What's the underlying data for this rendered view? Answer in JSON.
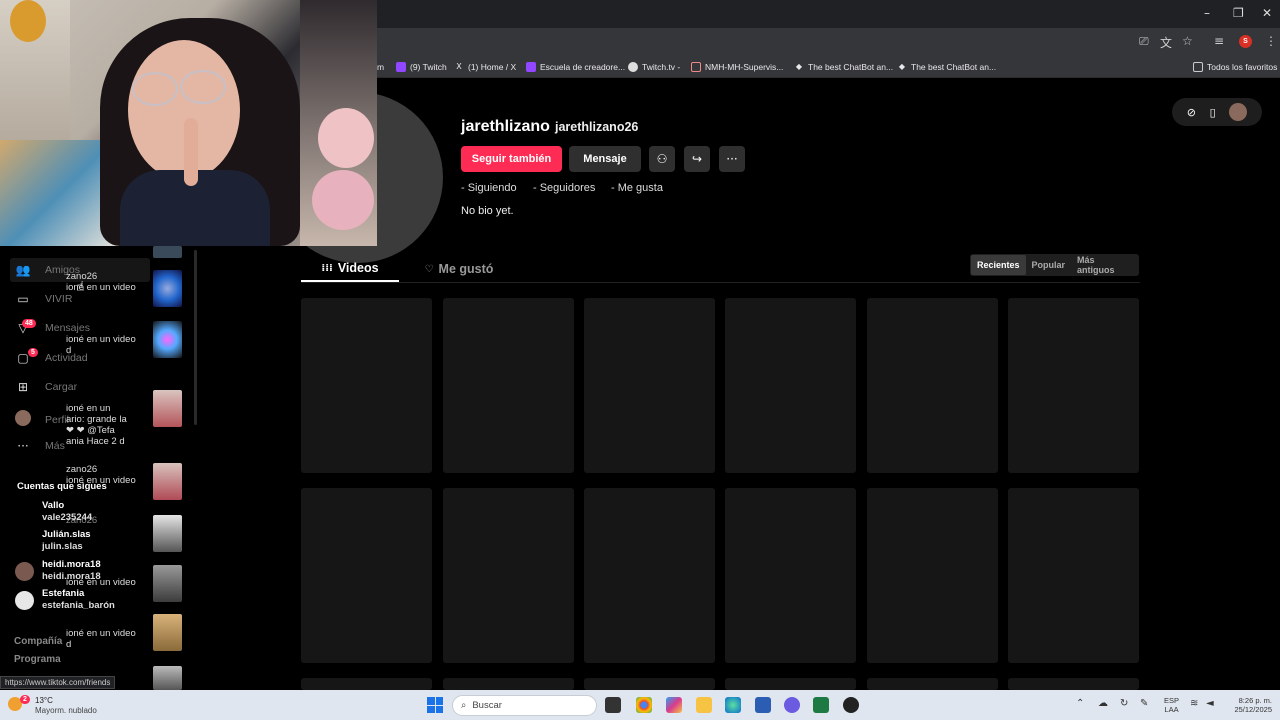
{
  "browser": {
    "window_controls": {
      "minimize": "–",
      "maximize": "❐",
      "close": "✕"
    },
    "bookmarks": [
      {
        "label": "m",
        "icon": ""
      },
      {
        "label": "(9) Twitch",
        "icon": "twitch-icon"
      },
      {
        "label": "(1) Home / X",
        "icon": "x-icon"
      },
      {
        "label": "Escuela de creadore...",
        "icon": "twitch-icon"
      },
      {
        "label": "Twitch.tv -",
        "icon": "globe-icon"
      },
      {
        "label": "NMH-MH-Supervis...",
        "icon": "doc-icon"
      },
      {
        "label": "The best ChatBot an...",
        "icon": "bot-icon"
      },
      {
        "label": "The best ChatBot an...",
        "icon": "bot-icon"
      }
    ],
    "all_bookmarks": "Todos los favoritos",
    "profile_initial": "S"
  },
  "profile": {
    "name": "jarethlizano",
    "handle": "jarethlizano26",
    "follow_label": "Seguir también",
    "message_label": "Mensaje",
    "stats": {
      "following": "- Siguiendo",
      "followers": "- Seguidores",
      "likes": "- Me gusta"
    },
    "bio": "No bio yet."
  },
  "tabs": {
    "videos": "Videos",
    "liked": "Me gustó"
  },
  "sort": [
    "Recientes",
    "Popular",
    "Más antiguos"
  ],
  "sidebar": {
    "nav": [
      {
        "label": "Amigos",
        "icon": "👥"
      },
      {
        "label": "VIVIR",
        "icon": "▭"
      },
      {
        "label": "Mensajes",
        "icon": "▽",
        "badge": "48"
      },
      {
        "label": "Actividad",
        "icon": "▢",
        "badge": "5"
      },
      {
        "label": "Cargar",
        "icon": "⊞"
      },
      {
        "label": "Perfil",
        "icon": ""
      },
      {
        "label": "Más",
        "icon": "···"
      }
    ],
    "notifications": [
      {
        "line1": "zano26",
        "line2": "ioné en un video"
      },
      {
        "line1": "ioné en un video",
        "line2": "d"
      },
      {
        "line1": "ioné en un",
        "line2": "ario: grande la"
      },
      {
        "line1": "❤ ❤ @Tefa",
        "line2": "ania  Hace 2 d"
      },
      {
        "line1": "zano26",
        "line2": "ioné en un video"
      },
      {
        "line1": "zano26",
        "line2": ""
      },
      {
        "line1": "ioné en un video",
        "line2": ""
      },
      {
        "line1": "ioné en un video",
        "line2": "d"
      }
    ],
    "following_header": "Cuentas que sigues",
    "following": [
      {
        "name": "Vallo",
        "handle": "vale235244"
      },
      {
        "name": "Julián.slas",
        "handle": "julin.slas"
      },
      {
        "name": "heidi.mora18",
        "handle": "heidi.mora18"
      },
      {
        "name": "Estefania",
        "handle": "estefania_barón"
      }
    ],
    "footer": [
      "Compañía",
      "Programa"
    ]
  },
  "status_url": "https://www.tiktok.com/friends",
  "taskbar": {
    "weather_temp": "13°C",
    "weather_desc": "Mayorm. nublado",
    "weather_badge": "2",
    "search_placeholder": "Buscar",
    "lang_1": "ESP",
    "lang_2": "LAA",
    "time": "8:26 p. m.",
    "date": "25/12/2025"
  },
  "colors": {
    "accent": "#fe2c55",
    "background": "#000000",
    "placeholder": "#161616"
  }
}
